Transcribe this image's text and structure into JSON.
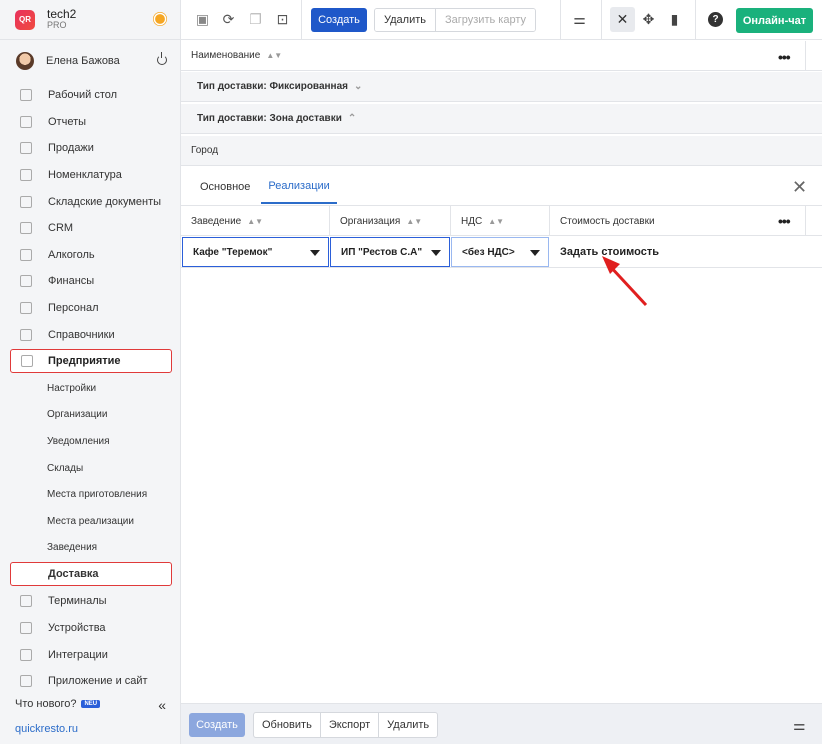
{
  "brand": {
    "logo_text": "QR",
    "name": "tech2",
    "plan": "PRO"
  },
  "user": {
    "name": "Елена Бажова"
  },
  "nav": [
    {
      "label": "Рабочий стол",
      "icon": "gauge-icon"
    },
    {
      "label": "Отчеты",
      "icon": "chart-icon"
    },
    {
      "label": "Продажи",
      "icon": "basket-icon"
    },
    {
      "label": "Номенклатура",
      "icon": "tag-icon"
    },
    {
      "label": "Складские документы",
      "icon": "warehouse-icon"
    },
    {
      "label": "CRM",
      "icon": "crm-icon"
    },
    {
      "label": "Алкоголь",
      "icon": "glass-icon"
    },
    {
      "label": "Финансы",
      "icon": "wallet-icon"
    },
    {
      "label": "Персонал",
      "icon": "people-icon"
    },
    {
      "label": "Справочники",
      "icon": "book-icon"
    }
  ],
  "enterprise": {
    "label": "Предприятие",
    "subitems": [
      "Настройки",
      "Организации",
      "Уведомления",
      "Склады",
      "Места приготовления",
      "Места реализации",
      "Заведения",
      "Доставка"
    ]
  },
  "nav_bottom": [
    {
      "label": "Терминалы",
      "icon": "terminal-icon"
    },
    {
      "label": "Устройства",
      "icon": "printer-icon"
    },
    {
      "label": "Интеграции",
      "icon": "link-icon"
    },
    {
      "label": "Приложение и сайт",
      "icon": "app-icon"
    }
  ],
  "whats_new": {
    "label": "Что нового?",
    "badge": "NEU"
  },
  "collapse_glyph": "«",
  "site_link": "quickresto.ru",
  "toolbar": {
    "create": "Создать",
    "delete": "Удалить",
    "load_map": "Загрузить карту",
    "chat": "Онлайн-чат",
    "help_glyph": "?"
  },
  "main": {
    "name_header": "Наименование",
    "group_fixed": "Тип доставки: Фиксированная",
    "group_zone": "Тип доставки: Зона доставки",
    "city_row": "Город",
    "tabs": [
      "Основное",
      "Реализации"
    ],
    "columns": [
      "Заведение",
      "Организация",
      "НДС",
      "Стоимость доставки"
    ],
    "row": {
      "venue": "Кафе \"Теремок\"",
      "org": "ИП \"Рестов С.А\"",
      "vat": "<без НДС>",
      "cost": "Задать стоимость"
    }
  },
  "footer": {
    "create": "Создать",
    "refresh": "Обновить",
    "export": "Экспорт",
    "delete": "Удалить"
  },
  "colors": {
    "primary": "#1f58c9",
    "chat": "#1ab17c",
    "highlight": "#e03a3a",
    "link": "#2b6cc9"
  }
}
